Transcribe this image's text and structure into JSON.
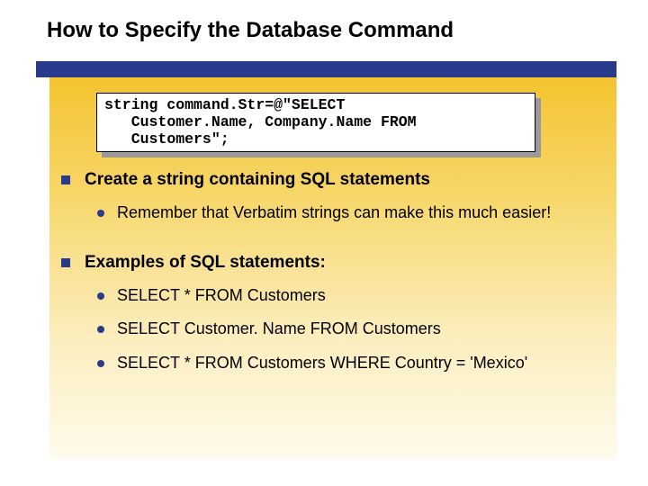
{
  "title": "How to Specify the Database Command",
  "code": "string command.Str=@\"SELECT\n   Customer.Name, Company.Name FROM\n   Customers\";",
  "bullets": [
    {
      "text": "Create a string containing SQL statements",
      "sub": [
        "Remember that Verbatim strings can make this much easier!"
      ]
    },
    {
      "text": "Examples of SQL statements:",
      "sub": [
        "SELECT * FROM Customers",
        "SELECT Customer. Name FROM Customers",
        "SELECT * FROM Customers WHERE Country = 'Mexico'"
      ]
    }
  ]
}
